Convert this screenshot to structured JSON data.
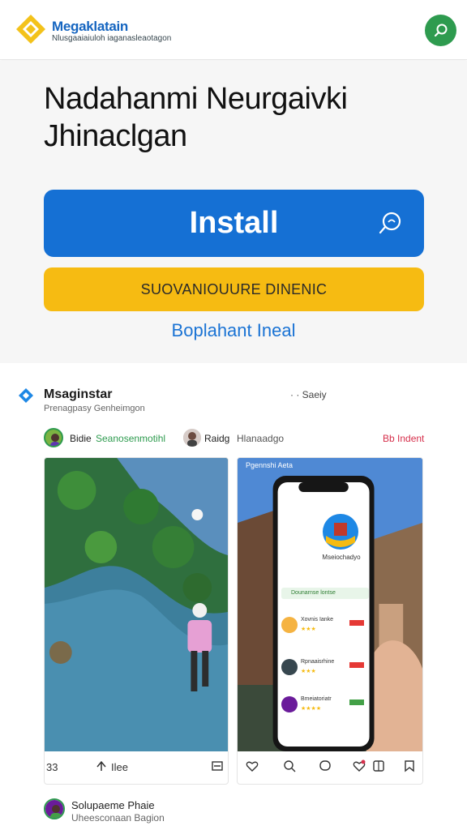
{
  "header": {
    "brand_name": "Megaklatain",
    "brand_sub": "Nlusgaaiaiuloh iaganasleaotagon",
    "logo_icon": "diamond-logo-icon",
    "search_icon": "search-icon"
  },
  "hero": {
    "title_line1": "Nadahanmi Neurgaivki",
    "title_line2": "Jhinaclgan",
    "install_label": "Install",
    "secondary_label": "SUOVANIOUURE DINENIC",
    "link_label": "Boplahant Ineal"
  },
  "feed": {
    "brand": "Msaginstar",
    "sub": "Prenagpasy Genheimgon",
    "meta": "· · Saeiy",
    "users": [
      {
        "name": "Bidie",
        "tag": "Seanosenmotihl"
      },
      {
        "name": "Raidg",
        "tag": "Hlanaadgo"
      }
    ],
    "indent_label": "Bb Indent",
    "left_card": {
      "count": "33",
      "share_label": "Ilee"
    },
    "right_card": {
      "status": "Pgennshi Aeta",
      "profile_name": "Mseiochadyo",
      "green_label": "Dounarnse lontse",
      "list": [
        {
          "name": "Xovnis Ianke",
          "badge_color": "#e53935"
        },
        {
          "name": "Rpnaaisrhine",
          "badge_color": "#e53935"
        },
        {
          "name": "Bmeiatoriatr",
          "badge_color": "#43a047"
        }
      ]
    },
    "bottom_user": {
      "name": "Solupaeme Phaie",
      "sub": "Uheesconaan Bagion"
    }
  },
  "colors": {
    "primary": "#1570d4",
    "accent": "#f6bb12",
    "green": "#2e9b4f",
    "red": "#d62f4b"
  }
}
